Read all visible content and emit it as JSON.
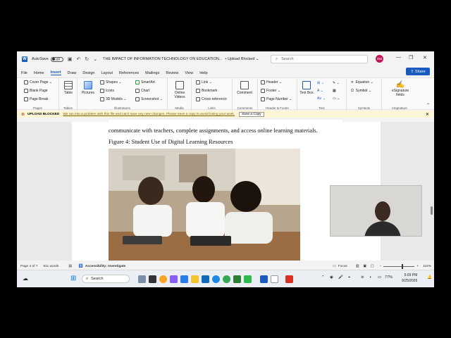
{
  "app": {
    "autosave_label": "AutoSave",
    "autosave_state": "Off",
    "doc_title": "THE IMPACT OF INFORMATION TECHNOLOGY ON EDUCATION...",
    "upload_status": "Upload Blocked",
    "search_placeholder": "Search",
    "avatar_initials": "OM"
  },
  "menu": {
    "items": [
      "File",
      "Home",
      "Insert",
      "Draw",
      "Design",
      "Layout",
      "References",
      "Mailings",
      "Review",
      "View",
      "Help"
    ],
    "share_label": "Share"
  },
  "ribbon": {
    "pages": {
      "items": [
        "Cover Page",
        "Blank Page",
        "Page Break"
      ],
      "label": "Pages"
    },
    "tables": {
      "item": "Table",
      "label": "Tables"
    },
    "illustrations": {
      "pictures": "Pictures",
      "items": [
        "Shapes",
        "Icons",
        "3D Models",
        "SmartArt",
        "Chart",
        "Screenshot"
      ],
      "label": "Illustrations"
    },
    "media": {
      "item": "Online Videos",
      "label": "Media"
    },
    "links": {
      "items": [
        "Link",
        "Bookmark",
        "Cross-reference"
      ],
      "label": "Links"
    },
    "comments": {
      "item": "Comment",
      "label": "Comments"
    },
    "header_footer": {
      "items": [
        "Header",
        "Footer",
        "Page Number"
      ],
      "label": "Header & Footer"
    },
    "text": {
      "item": "Text Box",
      "label": "Text"
    },
    "symbols": {
      "items": [
        "Equation",
        "Symbol"
      ],
      "label": "Symbols"
    },
    "esignature": {
      "item": "eSignature fields",
      "label": "eSignature"
    }
  },
  "message_bar": {
    "title": "UPLOAD BLOCKED",
    "text": "We ran into a problem with this file and can't save any new changes. Please save a copy to avoid losing your work.",
    "button": "Save a Copy"
  },
  "document": {
    "paragraph": "communicate with teachers, complete assignments, and access online learning materials.",
    "caption": "Figure 4: Student Use of Digital Learning Resources"
  },
  "status": {
    "page": "Page 4 of 7",
    "words": "611 words",
    "accessibility": "Accessibility: Investigate",
    "focus": "Focus",
    "zoom": "116%"
  },
  "taskbar": {
    "search_placeholder": "Search",
    "battery": "77%",
    "time": "5:09 PM",
    "date": "9/25/2026"
  }
}
